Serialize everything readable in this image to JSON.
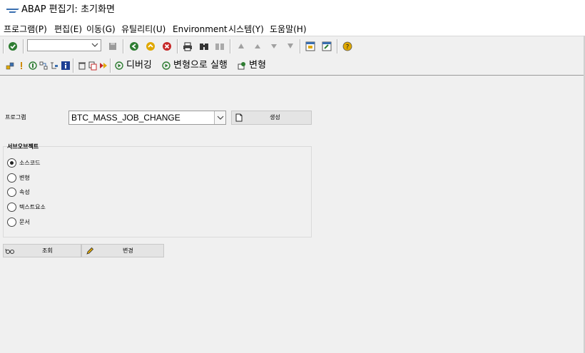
{
  "window": {
    "title": "ABAP 편집기: 초기화면"
  },
  "menubar": {
    "items": [
      "프로그램(P)",
      "편집(E)",
      "이동(G)",
      "유틸리티(U)",
      "Environment",
      "시스템(Y)",
      "도움말(H)"
    ]
  },
  "toolbar": {
    "command_field_value": "",
    "debug_label": "디버깅",
    "execute_with_variant_label": "변형으로 실행",
    "variants_label": "변형"
  },
  "selection": {
    "program_label": "프로그램",
    "program_value": "BTC_MASS_JOB_CHANGE",
    "create_label": "생성"
  },
  "subobjects": {
    "title": "서브오브젝트",
    "options": [
      {
        "label": "소스코드",
        "selected": true
      },
      {
        "label": "변형",
        "selected": false
      },
      {
        "label": "속성",
        "selected": false
      },
      {
        "label": "텍스트요소",
        "selected": false
      },
      {
        "label": "문서",
        "selected": false
      }
    ]
  },
  "actions": {
    "display_label": "조회",
    "change_label": "변경"
  },
  "colors": {
    "accent": "#3a6fb0",
    "ok_green": "#2e7d32",
    "exit_yellow": "#e0a800",
    "cancel_red": "#c62828"
  }
}
